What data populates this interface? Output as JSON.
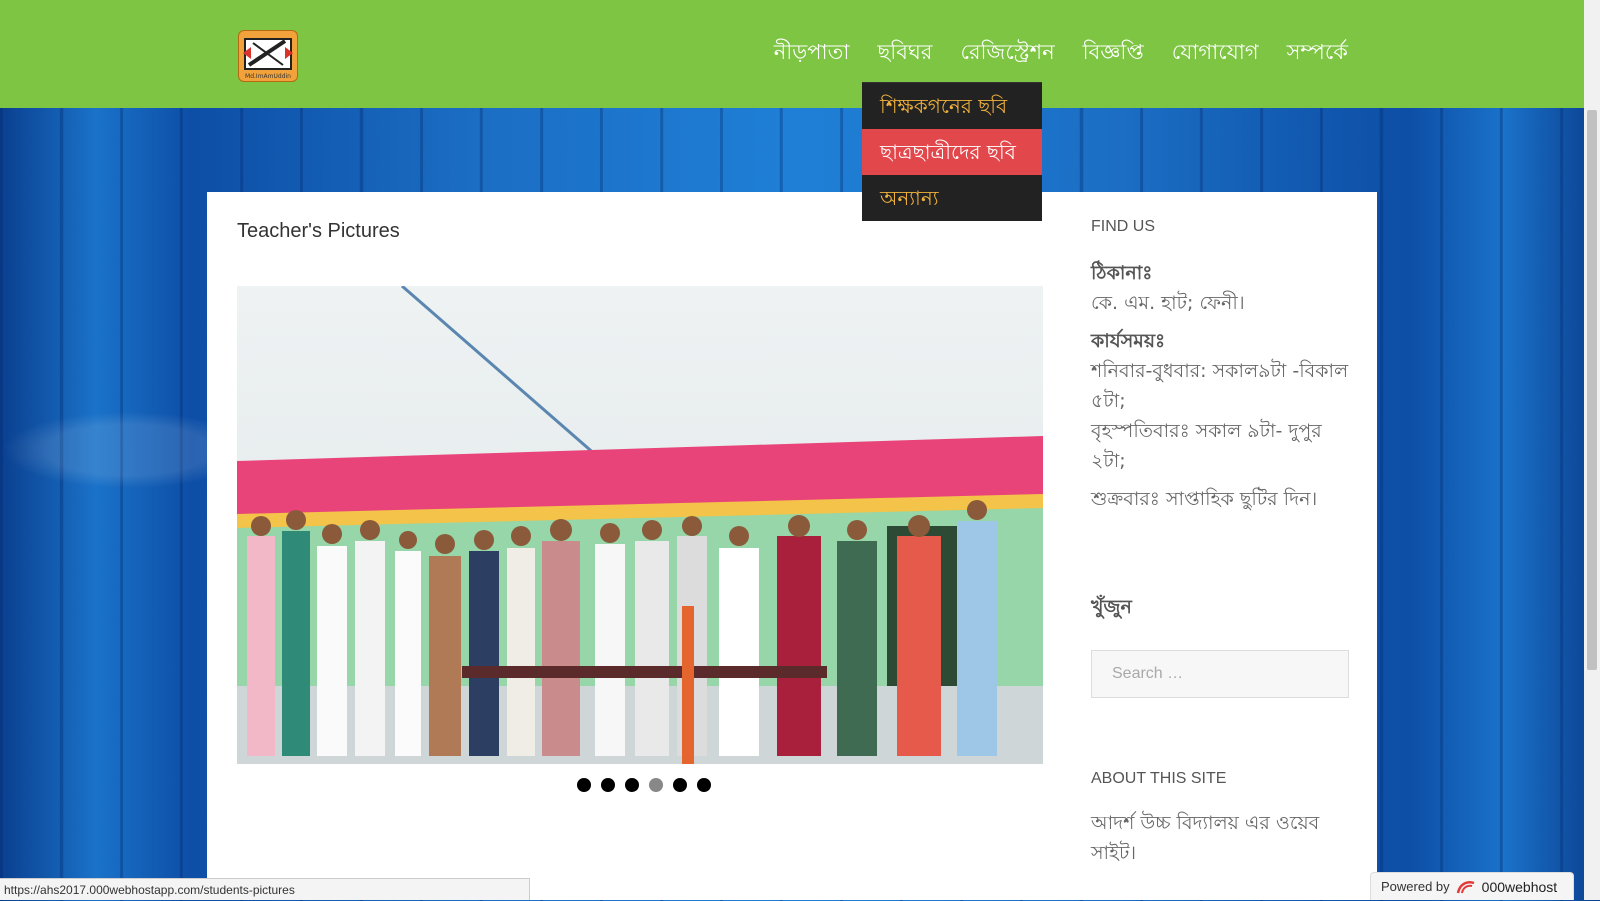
{
  "header": {
    "logo_text": "Md.ImAmUddin",
    "nav": [
      "নীড়পাতা",
      "ছবিঘর",
      "রেজিস্ট্রেশন",
      "বিজ্ঞপ্তি",
      "যোগাযোগ",
      "সম্পর্কে"
    ]
  },
  "dropdown": {
    "items": [
      "শিক্ষকগনের ছবি",
      "ছাত্রছাত্রীদের ছবি",
      "অন্যান্য"
    ],
    "active_index": 1
  },
  "main": {
    "title": "Teacher's Pictures",
    "slider": {
      "dot_count": 6,
      "active_dot": 4
    }
  },
  "sidebar": {
    "find_us_title": "FIND US",
    "address_label": "ঠিকানাঃ",
    "address": "কে. এম. হাট; ফেনী।",
    "hours_label": "কার্যসময়ঃ",
    "hours_1": "শনিবার-বুধবার: সকাল৯টা -বিকাল ৫টা;",
    "hours_2": "বৃহস্পতিবারঃ সকাল ৯টা- দুপুর ২টা;",
    "hours_3": "শুক্রবারঃ সাপ্তাহিক ছুটির দিন।",
    "search_title": "খুঁজুন",
    "search_placeholder": "Search …",
    "about_title": "ABOUT THIS SITE",
    "about_text": "আদর্শ উচ্চ বিদ্যালয় এর ওয়েব সাইট।"
  },
  "statusbar": {
    "url": "https://ahs2017.000webhostapp.com/students-pictures"
  },
  "powered": {
    "label": "Powered by",
    "brand": "000webhost"
  },
  "colors": {
    "header": "#7ec543",
    "dropdown_bg": "#222222",
    "dropdown_text": "#f0b13c",
    "dropdown_active": "#e2474c"
  }
}
